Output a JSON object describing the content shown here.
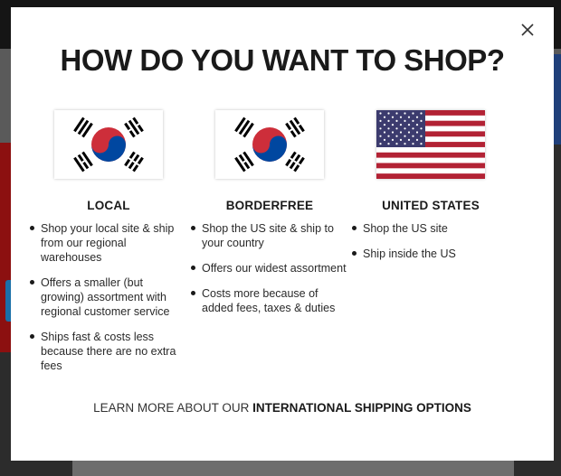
{
  "modal": {
    "title": "HOW DO YOU WANT TO SHOP?",
    "close_icon": "close-icon"
  },
  "options": [
    {
      "id": "local",
      "flag": "south-korea-flag-icon",
      "heading": "LOCAL",
      "bullets": [
        "Shop your local site & ship from our regional warehouses",
        "Offers a smaller (but growing) assortment with regional customer service",
        "Ships fast & costs less because there are no extra fees"
      ]
    },
    {
      "id": "borderfree",
      "flag": "south-korea-flag-icon",
      "heading": "BORDERFREE",
      "bullets": [
        "Shop the US site & ship to your country",
        "Offers our widest assortment",
        "Costs more because of added fees, taxes & duties"
      ]
    },
    {
      "id": "united-states",
      "flag": "us-flag-icon",
      "heading": "UNITED STATES",
      "bullets": [
        "Shop the US site",
        "Ship inside the US"
      ]
    }
  ],
  "footer": {
    "prefix": "LEARN MORE ABOUT OUR ",
    "link": "INTERNATIONAL SHIPPING OPTIONS"
  },
  "colors": {
    "korea_red": "#cd2e3a",
    "korea_blue": "#0047a0",
    "us_red": "#b22234",
    "us_blue": "#3c3b6e"
  }
}
